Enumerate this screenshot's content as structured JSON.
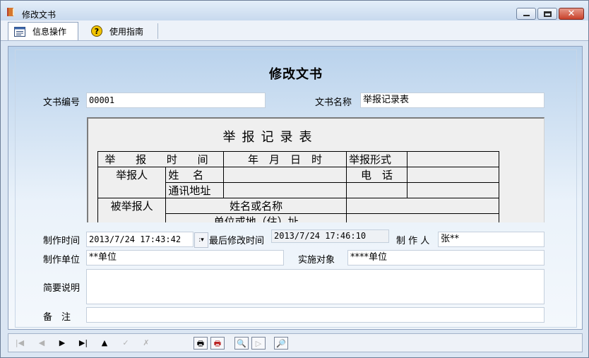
{
  "window": {
    "title": "修改文书",
    "close_glyph": "✕"
  },
  "toolbar": {
    "tabs": [
      {
        "label": "信息操作"
      },
      {
        "label": "使用指南"
      }
    ]
  },
  "form": {
    "title": "修改文书",
    "doc_number_label": "文书编号",
    "doc_number_value": "00001",
    "doc_name_label": "文书名称",
    "doc_name_value": "举报记录表",
    "created_time_label": "制作时间",
    "created_time_value": "2013/7/24 17:43:42",
    "combo_arrow_glyph": ":▾",
    "modified_time_label": "最后修改时间",
    "modified_time_value": "2013/7/24 17:46:10",
    "author_label": "制 作 人",
    "author_value": "张**",
    "unit_label": "制作单位",
    "unit_value": "**单位",
    "target_label": "实施对象",
    "target_value": "****单位",
    "summary_label": "简要说明",
    "summary_value": "",
    "remarks_label": "备　注",
    "remarks_value": ""
  },
  "document": {
    "title": "举报记录表",
    "rows": {
      "r1c1": "举 报 时 间",
      "r1c2": "年　月　日　时",
      "r1c3": "举报形式",
      "r2c1": "举报人",
      "r2c2": "姓　 名",
      "r2c4": "电　话",
      "r3c2": "通讯地址",
      "r4c1": "被举报人",
      "r4c2": "姓名或名称",
      "r5c2": "单位或地（住）址"
    }
  },
  "icons": {
    "title": "book-icon",
    "info_tab": "form-icon",
    "guide_tab": "help-icon",
    "nav": [
      "first-icon",
      "prev-icon",
      "next-icon",
      "last-icon",
      "up-icon",
      "confirm-icon",
      "cancel-icon",
      "print-icon",
      "print-preview-icon",
      "zoom-icon",
      "play-icon",
      "search-icon"
    ]
  },
  "navbar": {
    "first": "|◀",
    "prev": "◀",
    "next": "▶",
    "last": "▶|",
    "up": "▲",
    "confirm": "✓",
    "cancel": "✗",
    "print": "🖶",
    "print_red": "🖶",
    "preview": "🔍",
    "play": "▷",
    "search": "🔎"
  }
}
